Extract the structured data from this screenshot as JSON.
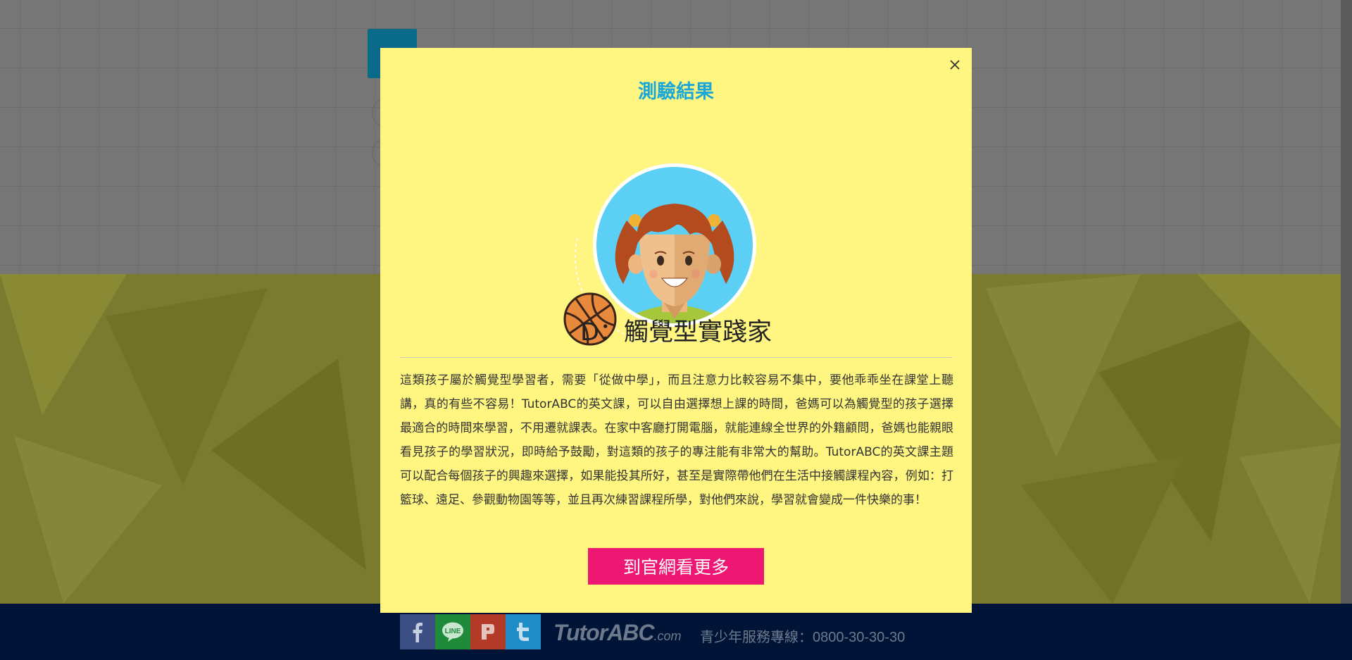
{
  "modal": {
    "heading": "測驗結果",
    "result_title": "D：觸覺型實踐家",
    "description": "這類孩子屬於觸覺型學習者，需要「從做中學」，而且注意力比較容易不集中，要他乖乖坐在課堂上聽講，真的有些不容易！TutorABC的英文課，可以自由選擇想上課的時間，爸媽可以為觸覺型的孩子選擇最適合的時間來學習，不用遷就課表。在家中客廳打開電腦，就能連線全世界的外籍顧問，爸媽也能親眼看見孩子的學習狀況，即時給予鼓勵，對這類的孩子的專注能有非常大的幫助。TutorABC的英文課主題可以配合每個孩子的興趣來選擇，如果能投其所好，甚至是實際帶他們在生活中接觸課程內容，例如：打籃球、遠足、參觀動物園等等，並且再次練習課程所學，對他們來說，學習就會變成一件快樂的事！",
    "cta_label": "到官網看更多",
    "close_icon": "close-icon",
    "illustration_icons": [
      "girl-avatar-icon",
      "basketball-icon"
    ]
  },
  "footer": {
    "social": [
      {
        "name": "facebook",
        "letter": "f",
        "color": "#3b4f84"
      },
      {
        "name": "line",
        "letter": "LINE",
        "color": "#1f8a39"
      },
      {
        "name": "plurk",
        "letter": "P",
        "color": "#b23a26"
      },
      {
        "name": "twitter",
        "letter": "t",
        "color": "#1e8cc7"
      }
    ],
    "brand_name": "TutorABC",
    "brand_domain": ".com",
    "hotline": "青少年服務專線：0800-30-30-30"
  },
  "colors": {
    "modal_bg": "#fff581",
    "heading": "#1ba7d8",
    "cta_bg": "#ee1773",
    "footer_bg": "#001437"
  }
}
